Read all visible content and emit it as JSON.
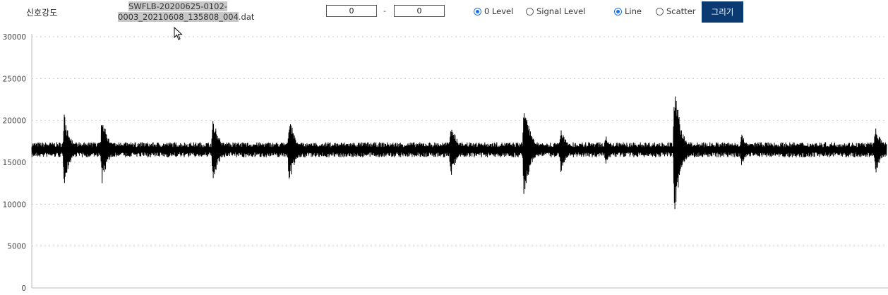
{
  "header": {
    "signal_label": "신호강도",
    "file_name_line1": "SWFLB-20200625-0102-",
    "file_name_line2_highlight": "0003_20210608_135808_004",
    "file_name_line2_rest": ".dat",
    "range_start": "0",
    "range_sep": "-",
    "range_end": "0",
    "level_options": [
      "0 Level",
      "Signal Level"
    ],
    "level_selected": "0 Level",
    "plot_options": [
      "Line",
      "Scatter"
    ],
    "plot_selected": "Line",
    "draw_button": "그리기"
  },
  "colors": {
    "accent": "#1a73e8",
    "button_bg": "#0b3a72",
    "signal": "#000000",
    "grid": "#cccccc"
  },
  "icons": {
    "cursor": "mouse-pointer-icon"
  },
  "chart_data": {
    "type": "line",
    "title": "",
    "xlabel": "",
    "ylabel": "",
    "ylim": [
      0,
      30000
    ],
    "yticks": [
      0,
      5000,
      10000,
      15000,
      20000,
      25000,
      30000
    ],
    "ytick_labels": [
      "0",
      "5000",
      "10000",
      "15000",
      "20000",
      "25000",
      "30000"
    ],
    "grid": "horizontal dotted",
    "series": [
      {
        "color": "#000000",
        "x_range": [
          0,
          1000
        ],
        "baseline": 16500,
        "baseline_noise": 900,
        "bursts": [
          {
            "x": 38,
            "max": 20900,
            "min": 12200
          },
          {
            "x": 82,
            "max": 21000,
            "min": 12100
          },
          {
            "x": 212,
            "max": 20800,
            "min": 12100
          },
          {
            "x": 301,
            "max": 20700,
            "min": 11800
          },
          {
            "x": 490,
            "max": 19600,
            "min": 12000
          },
          {
            "x": 576,
            "max": 23000,
            "min": 10300
          },
          {
            "x": 619,
            "max": 19300,
            "min": 13800
          },
          {
            "x": 671,
            "max": 18500,
            "min": 14800
          },
          {
            "x": 752,
            "max": 25100,
            "min": 8300
          },
          {
            "x": 830,
            "max": 18500,
            "min": 14500
          },
          {
            "x": 987,
            "max": 19700,
            "min": 13300
          }
        ]
      }
    ]
  }
}
